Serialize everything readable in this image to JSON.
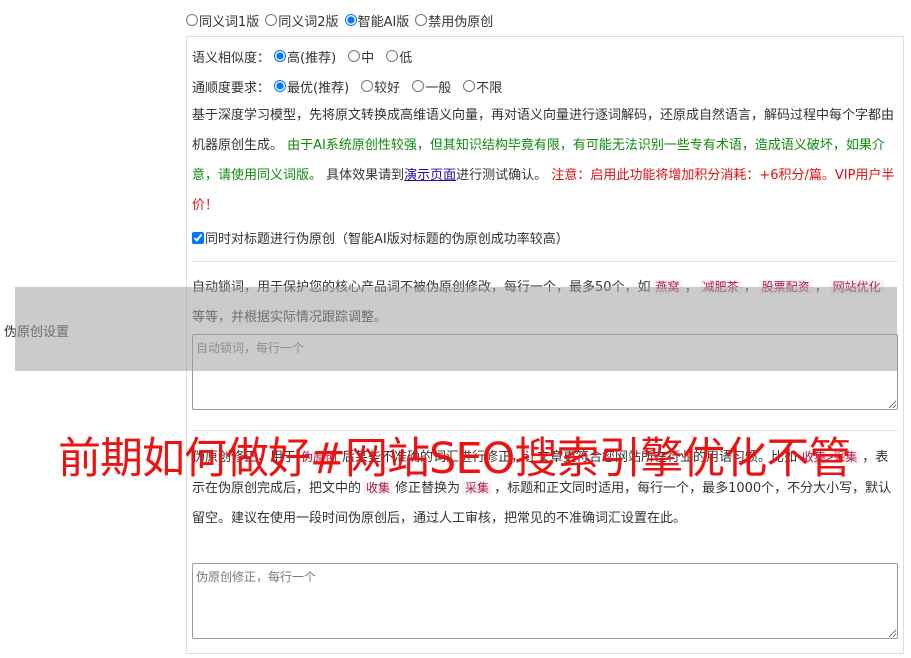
{
  "mode_options": [
    {
      "label": "同义词1版",
      "checked": false
    },
    {
      "label": "同义词2版",
      "checked": false
    },
    {
      "label": "智能AI版",
      "checked": true
    },
    {
      "label": "禁用伪原创",
      "checked": false
    }
  ],
  "similarity": {
    "label": "语义相似度：",
    "options": [
      {
        "label": "高(推荐)",
        "checked": true
      },
      {
        "label": "中",
        "checked": false
      },
      {
        "label": "低",
        "checked": false
      }
    ]
  },
  "fluency": {
    "label": "通顺度要求：",
    "options": [
      {
        "label": "最优(推荐)",
        "checked": true
      },
      {
        "label": "较好",
        "checked": false
      },
      {
        "label": "一般",
        "checked": false
      },
      {
        "label": "不限",
        "checked": false
      }
    ]
  },
  "description": {
    "part1": "基于深度学习模型，先将原文转换成高维语义向量，再对语义向量进行逐词解码，还原成自然语言，解码过程中每个字都由机器原创生成。 ",
    "green": "由于AI系统原创性较强，但其知识结构毕竟有限，有可能无法识别一些专有术语，造成语义破坏，如果介意，请使用同义词版。",
    "part2": " 具体效果请到",
    "link": "演示页面",
    "part3": "进行测试确认。 ",
    "red": "注意：启用此功能将增加积分消耗：+6积分/篇。VIP用户半价！"
  },
  "title_checkbox": {
    "label": "同时对标题进行伪原创（智能AI版对标题的伪原创成功率较高）",
    "checked": true
  },
  "lock_words": {
    "desc_prefix": "自动锁词，用于保护您的核心产品词不被伪原创修改，每行一个，最多50个，如",
    "examples": [
      "燕窝",
      "减肥茶",
      "股票配资",
      "网站优化"
    ],
    "desc_suffix": "等等，并根据实际情况跟踪调整。",
    "placeholder": "自动锁词，每行一个"
  },
  "side_label": "伪原创设置",
  "correction": {
    "desc_prefix": "伪原创修正，用于",
    "desc_tag1": "伪原创",
    "desc_mid1": "后某些不准确的词汇进行修正，让文章更符合您网站所在行业的用语习惯。比如",
    "desc_tag2": "收集>采集",
    "desc_mid2": "，表示在伪原创完成后，把文中的",
    "desc_tag3": "收集",
    "desc_mid3": "修正替换为",
    "desc_tag4": "采集",
    "desc_suffix": "，标题和正文同时适用，每行一个，最多1000个，不分大小写，默认留空。建议在使用一段时间伪原创后，通过人工审核，把常见的不准确词汇设置在此。",
    "placeholder": "伪原创修正，每行一个"
  },
  "overlay_banner": "前期如何做好#网站SEO搜索引擎优化不管"
}
